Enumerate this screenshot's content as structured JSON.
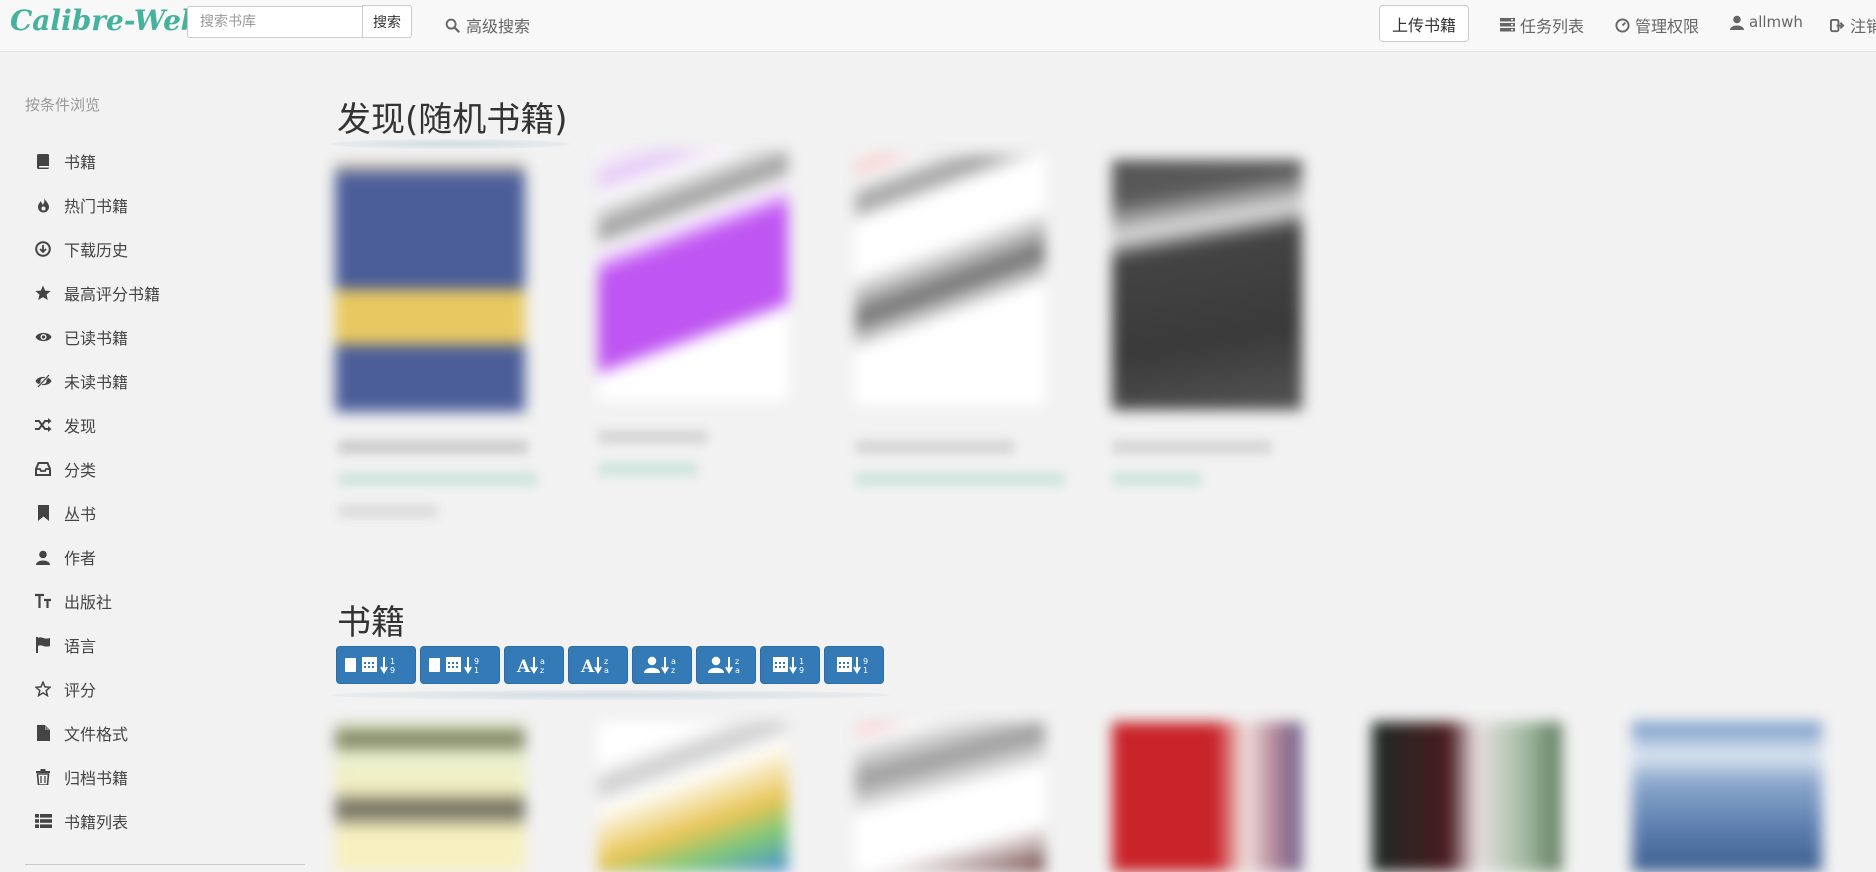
{
  "navbar": {
    "brand": "Calibre-Web",
    "search_placeholder": "搜索书库",
    "search_button": "搜索",
    "advanced_search": "高级搜索",
    "upload": "上传书籍",
    "tasks": "任务列表",
    "admin": "管理权限",
    "user": "allmwh",
    "logout": "注销"
  },
  "sidebar": {
    "header": "按条件浏览",
    "items": [
      {
        "label": "书籍",
        "icon": "book-icon"
      },
      {
        "label": "热门书籍",
        "icon": "fire-icon"
      },
      {
        "label": "下载历史",
        "icon": "download-circle-icon"
      },
      {
        "label": "最高评分书籍",
        "icon": "star-icon"
      },
      {
        "label": "已读书籍",
        "icon": "eye-icon"
      },
      {
        "label": "未读书籍",
        "icon": "eye-slash-icon"
      },
      {
        "label": "发现",
        "icon": "shuffle-icon"
      },
      {
        "label": "分类",
        "icon": "inbox-icon"
      },
      {
        "label": "丛书",
        "icon": "bookmark-icon"
      },
      {
        "label": "作者",
        "icon": "user-icon"
      },
      {
        "label": "出版社",
        "icon": "text-size-icon"
      },
      {
        "label": "语言",
        "icon": "flag-icon"
      },
      {
        "label": "评分",
        "icon": "star-outline-icon"
      },
      {
        "label": "文件格式",
        "icon": "file-icon"
      },
      {
        "label": "归档书籍",
        "icon": "trash-icon"
      },
      {
        "label": "书籍列表",
        "icon": "list-icon"
      }
    ]
  },
  "main": {
    "discover_title": "发现(随机书籍)",
    "books_title": "书籍",
    "sort_buttons": [
      {
        "icon": "sort-added-desc-icon"
      },
      {
        "icon": "sort-added-asc-icon"
      },
      {
        "icon": "sort-title-az-icon"
      },
      {
        "icon": "sort-title-za-icon"
      },
      {
        "icon": "sort-author-az-icon"
      },
      {
        "icon": "sort-author-za-icon"
      },
      {
        "icon": "sort-pubdate-desc-icon"
      },
      {
        "icon": "sort-pubdate-asc-icon"
      }
    ]
  },
  "colors": {
    "brand": "#45b29d",
    "primary_button": "#337ab7",
    "background": "#f2f2f2"
  }
}
